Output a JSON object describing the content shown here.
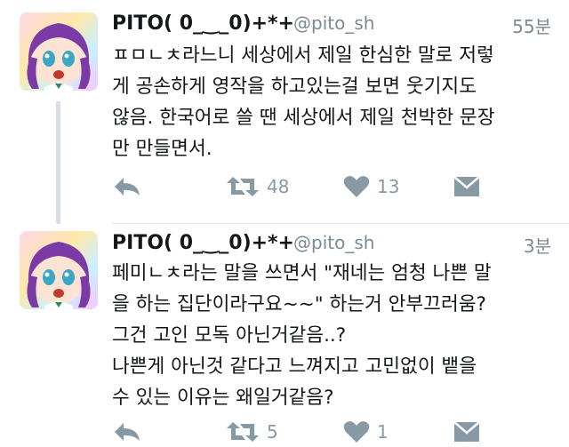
{
  "tweets": [
    {
      "display_name": "PITO( 0_‿_0)+*+",
      "handle": "@pito_sh",
      "time": "55분",
      "lines": [
        "ㅍㅁㄴㅊ라느니 세상에서 제일 한심한 말로 저렇",
        "게 공손하게 영작을 하고있는걸 보면 웃기지도",
        "않음. 한국어로 쓸 땐 세상에서 제일 천박한 문장",
        "만 만들면서."
      ],
      "retweets": "48",
      "likes": "13"
    },
    {
      "display_name": "PITO( 0_‿_0)+*+",
      "handle": "@pito_sh",
      "time": "3분",
      "lines": [
        "페미ㄴㅊ라는 말을 쓰면서 \"재네는 엄청 나쁜 말",
        "을 하는 집단이라구요~~\" 하는거 안부끄러움?",
        "그건 고인 모독 아닌거같음..?",
        "나쁜게 아닌것 같다고 느껴지고 고민없이 뱉을",
        "수 있는 이유는 왜일거같음?"
      ],
      "retweets": "5",
      "likes": "1"
    }
  ],
  "icons": {
    "reply": "reply-arrow-icon",
    "retweet": "retweet-icon",
    "like": "heart-icon",
    "dm": "envelope-icon"
  },
  "colors": {
    "text": "#14171a",
    "muted": "#7b8a97",
    "icon": "#8899a6",
    "avatar_hair": "#7b3aa6"
  }
}
